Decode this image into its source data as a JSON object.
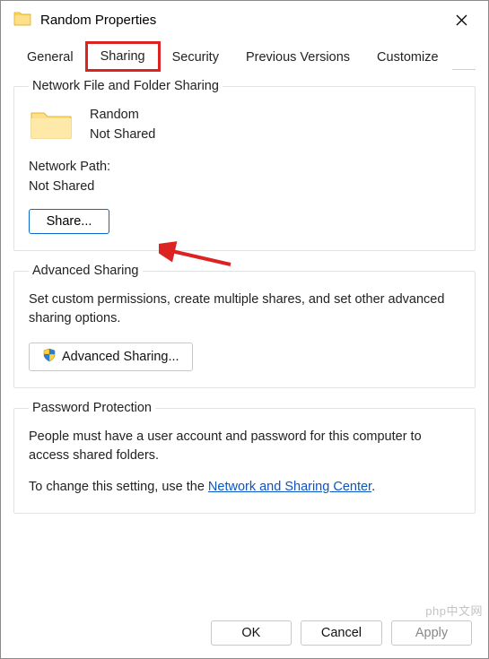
{
  "title": "Random Properties",
  "tabs": {
    "general": "General",
    "sharing": "Sharing",
    "security": "Security",
    "previous": "Previous Versions",
    "customize": "Customize"
  },
  "network_sharing": {
    "legend": "Network File and Folder Sharing",
    "folder_name": "Random",
    "share_status": "Not Shared",
    "path_label": "Network Path:",
    "path_value": "Not Shared",
    "share_button": "Share..."
  },
  "advanced_sharing": {
    "legend": "Advanced Sharing",
    "description": "Set custom permissions, create multiple shares, and set other advanced sharing options.",
    "button": "Advanced Sharing..."
  },
  "password_protection": {
    "legend": "Password Protection",
    "description": "People must have a user account and password for this computer to access shared folders.",
    "change_prefix": "To change this setting, use the ",
    "link_text": "Network and Sharing Center",
    "change_suffix": "."
  },
  "footer": {
    "ok": "OK",
    "cancel": "Cancel",
    "apply": "Apply"
  },
  "watermark": "php中文网"
}
